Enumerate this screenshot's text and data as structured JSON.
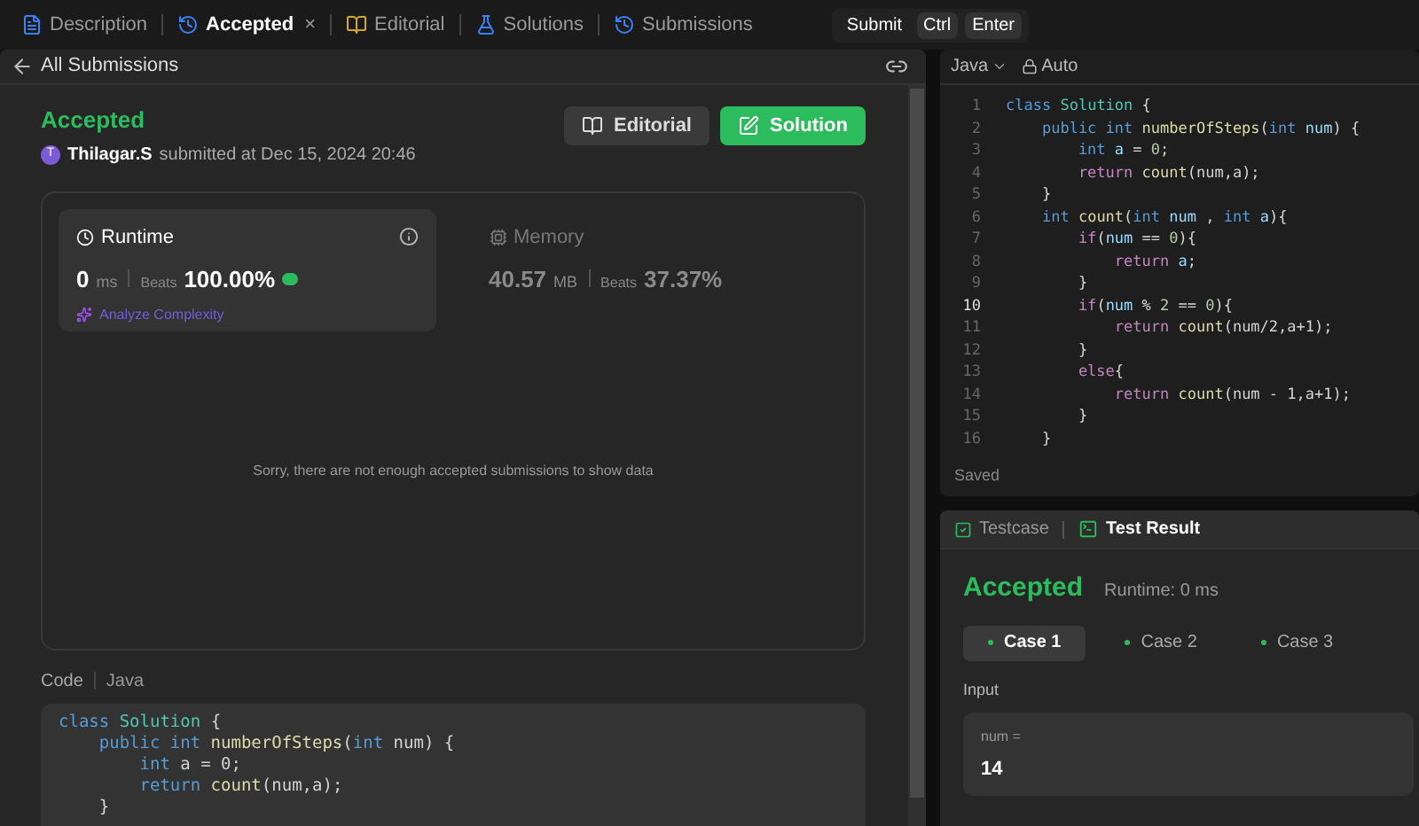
{
  "top_tabs": [
    {
      "label": "Description",
      "kind": "doc",
      "selected": false
    },
    {
      "label": "Accepted",
      "kind": "clock",
      "selected": true,
      "close": "×"
    },
    {
      "label": "Editorial",
      "kind": "book",
      "selected": false
    },
    {
      "label": "Solutions",
      "kind": "flask",
      "selected": false
    },
    {
      "label": "Submissions",
      "kind": "clock",
      "selected": false
    }
  ],
  "submit": {
    "label": "Submit",
    "keys": [
      "Ctrl",
      "Enter"
    ]
  },
  "back_link": "All Submissions",
  "submission": {
    "status": "Accepted",
    "avatar": "T",
    "user": "Thilagar.S",
    "submitted": "submitted at Dec 15, 2024 20:46"
  },
  "action_buttons": [
    {
      "label": "Editorial",
      "kind": "book"
    },
    {
      "label": "Solution",
      "kind": "edit"
    }
  ],
  "stats": [
    {
      "title": "Runtime",
      "kind": "clock",
      "selected": true,
      "value": "0",
      "unit": "ms",
      "beats_label": "Beats",
      "beats": "100.00%",
      "link": "Analyze Complexity"
    },
    {
      "title": "Memory",
      "kind": "chip",
      "selected": false,
      "value": "40.57",
      "unit": "MB",
      "beats_label": "Beats",
      "beats": "37.37%"
    }
  ],
  "empty_message": "Sorry, there are not enough accepted submissions to show data",
  "code_header": {
    "label": "Code",
    "language": "Java"
  },
  "code_preview": [
    [
      {
        "kind": "kw",
        "text": "class "
      },
      {
        "kind": "cls",
        "text": "Solution"
      },
      {
        "kind": "p",
        "text": " {"
      }
    ],
    [
      {
        "kind": "kw",
        "text": "    public int "
      },
      {
        "kind": "fn",
        "text": "numberOfSteps"
      },
      {
        "kind": "p",
        "text": "("
      },
      {
        "kind": "kw",
        "text": "int "
      },
      {
        "kind": "p",
        "text": "num) {"
      }
    ],
    [
      {
        "kind": "kw",
        "text": "        int "
      },
      {
        "kind": "p",
        "text": "a = 0;"
      }
    ],
    [
      {
        "kind": "kw",
        "text": "        return "
      },
      {
        "kind": "fn",
        "text": "count"
      },
      {
        "kind": "p",
        "text": "(num,a);"
      }
    ],
    [
      {
        "kind": "p",
        "text": "    }"
      }
    ]
  ],
  "editor": {
    "language": "Java",
    "mode": "Auto",
    "status": "Saved",
    "lines": [
      {
        "n": "1",
        "active": false,
        "tokens": [
          {
            "kind": "kw",
            "text": "class "
          },
          {
            "kind": "cls",
            "text": "Solution"
          },
          {
            "kind": "p",
            "text": " {"
          }
        ]
      },
      {
        "n": "2",
        "active": false,
        "tokens": [
          {
            "kind": "kw",
            "text": "    public int "
          },
          {
            "kind": "fn",
            "text": "numberOfSteps"
          },
          {
            "kind": "p",
            "text": "("
          },
          {
            "kind": "kw",
            "text": "int "
          },
          {
            "kind": "var",
            "text": "num"
          },
          {
            "kind": "p",
            "text": ") {"
          }
        ]
      },
      {
        "n": "3",
        "active": false,
        "tokens": [
          {
            "kind": "kw",
            "text": "        int "
          },
          {
            "kind": "var",
            "text": "a"
          },
          {
            "kind": "p",
            "text": " = "
          },
          {
            "kind": "num",
            "text": "0"
          },
          {
            "kind": "p",
            "text": ";"
          }
        ]
      },
      {
        "n": "4",
        "active": false,
        "tokens": [
          {
            "kind": "ctl",
            "text": "        return "
          },
          {
            "kind": "fn",
            "text": "count"
          },
          {
            "kind": "p",
            "text": "(num,a);"
          }
        ]
      },
      {
        "n": "5",
        "active": false,
        "tokens": [
          {
            "kind": "p",
            "text": "    }"
          }
        ]
      },
      {
        "n": "6",
        "active": false,
        "tokens": [
          {
            "kind": "kw",
            "text": "    int "
          },
          {
            "kind": "fn",
            "text": "count"
          },
          {
            "kind": "p",
            "text": "("
          },
          {
            "kind": "kw",
            "text": "int "
          },
          {
            "kind": "var",
            "text": "num"
          },
          {
            "kind": "p",
            "text": " , "
          },
          {
            "kind": "kw",
            "text": "int "
          },
          {
            "kind": "var",
            "text": "a"
          },
          {
            "kind": "p",
            "text": "){"
          }
        ]
      },
      {
        "n": "7",
        "active": false,
        "tokens": [
          {
            "kind": "ctl",
            "text": "        if"
          },
          {
            "kind": "p",
            "text": "("
          },
          {
            "kind": "var",
            "text": "num"
          },
          {
            "kind": "p",
            "text": " == "
          },
          {
            "kind": "num",
            "text": "0"
          },
          {
            "kind": "p",
            "text": "){"
          }
        ]
      },
      {
        "n": "8",
        "active": false,
        "tokens": [
          {
            "kind": "ctl",
            "text": "            return "
          },
          {
            "kind": "var",
            "text": "a"
          },
          {
            "kind": "p",
            "text": ";"
          }
        ]
      },
      {
        "n": "9",
        "active": false,
        "tokens": [
          {
            "kind": "p",
            "text": "        }"
          }
        ]
      },
      {
        "n": "10",
        "active": true,
        "tokens": [
          {
            "kind": "ctl",
            "text": "        if"
          },
          {
            "kind": "p",
            "text": "("
          },
          {
            "kind": "var",
            "text": "num"
          },
          {
            "kind": "p",
            "text": " % "
          },
          {
            "kind": "num",
            "text": "2"
          },
          {
            "kind": "p",
            "text": " == "
          },
          {
            "kind": "num",
            "text": "0"
          },
          {
            "kind": "p",
            "text": "){"
          }
        ]
      },
      {
        "n": "11",
        "active": false,
        "tokens": [
          {
            "kind": "ctl",
            "text": "            return "
          },
          {
            "kind": "fn",
            "text": "count"
          },
          {
            "kind": "p",
            "text": "(num/2,a+1);"
          }
        ]
      },
      {
        "n": "12",
        "active": false,
        "tokens": [
          {
            "kind": "p",
            "text": "        }"
          }
        ]
      },
      {
        "n": "13",
        "active": false,
        "tokens": [
          {
            "kind": "ctl",
            "text": "        else"
          },
          {
            "kind": "p",
            "text": "{"
          }
        ]
      },
      {
        "n": "14",
        "active": false,
        "tokens": [
          {
            "kind": "ctl",
            "text": "            return "
          },
          {
            "kind": "fn",
            "text": "count"
          },
          {
            "kind": "p",
            "text": "(num - 1,a+1);"
          }
        ]
      },
      {
        "n": "15",
        "active": false,
        "tokens": [
          {
            "kind": "p",
            "text": "        }"
          }
        ]
      },
      {
        "n": "16",
        "active": false,
        "tokens": [
          {
            "kind": "p",
            "text": "    }"
          }
        ]
      }
    ]
  },
  "result_tabs": [
    {
      "label": "Testcase",
      "kind": "check",
      "selected": false
    },
    {
      "label": "Test Result",
      "kind": "terminal",
      "selected": true
    }
  ],
  "result": {
    "status": "Accepted",
    "runtime": "Runtime: 0 ms",
    "cases": [
      {
        "label": "Case 1",
        "selected": true
      },
      {
        "label": "Case 2",
        "selected": false
      },
      {
        "label": "Case 3",
        "selected": false
      }
    ],
    "input_label": "Input",
    "param": "num =",
    "value": "14"
  }
}
